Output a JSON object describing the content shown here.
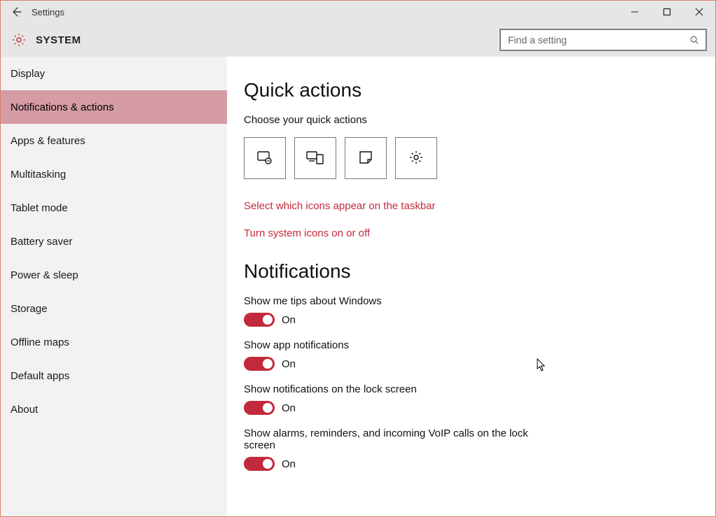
{
  "titlebar": {
    "title": "Settings"
  },
  "header": {
    "title": "SYSTEM",
    "search_placeholder": "Find a setting"
  },
  "sidebar": {
    "items": [
      {
        "label": "Display",
        "selected": false
      },
      {
        "label": "Notifications & actions",
        "selected": true
      },
      {
        "label": "Apps & features",
        "selected": false
      },
      {
        "label": "Multitasking",
        "selected": false
      },
      {
        "label": "Tablet mode",
        "selected": false
      },
      {
        "label": "Battery saver",
        "selected": false
      },
      {
        "label": "Power & sleep",
        "selected": false
      },
      {
        "label": "Storage",
        "selected": false
      },
      {
        "label": "Offline maps",
        "selected": false
      },
      {
        "label": "Default apps",
        "selected": false
      },
      {
        "label": "About",
        "selected": false
      }
    ]
  },
  "content": {
    "section1_title": "Quick actions",
    "section1_sub": "Choose your quick actions",
    "quick_tiles": [
      "tablet-mode-icon",
      "connect-icon",
      "note-icon",
      "all-settings-icon"
    ],
    "link1": "Select which icons appear on the taskbar",
    "link2": "Turn system icons on or off",
    "section2_title": "Notifications",
    "toggles": [
      {
        "label": "Show me tips about Windows",
        "state": "On"
      },
      {
        "label": "Show app notifications",
        "state": "On"
      },
      {
        "label": "Show notifications on the lock screen",
        "state": "On"
      },
      {
        "label": "Show alarms, reminders, and incoming VoIP calls on the lock screen",
        "state": "On"
      }
    ]
  }
}
